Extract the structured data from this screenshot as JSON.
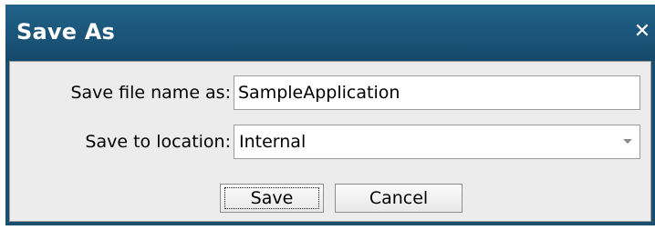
{
  "dialog": {
    "title": "Save As",
    "close_label": "✕"
  },
  "form": {
    "file_name_label": "Save file name as:",
    "file_name_value": "SampleApplication",
    "location_label": "Save to location:",
    "location_value": "Internal"
  },
  "buttons": {
    "save_label": "Save",
    "cancel_label": "Cancel"
  },
  "colors": {
    "titlebar": "#1a5579",
    "body_bg": "#ececec"
  }
}
